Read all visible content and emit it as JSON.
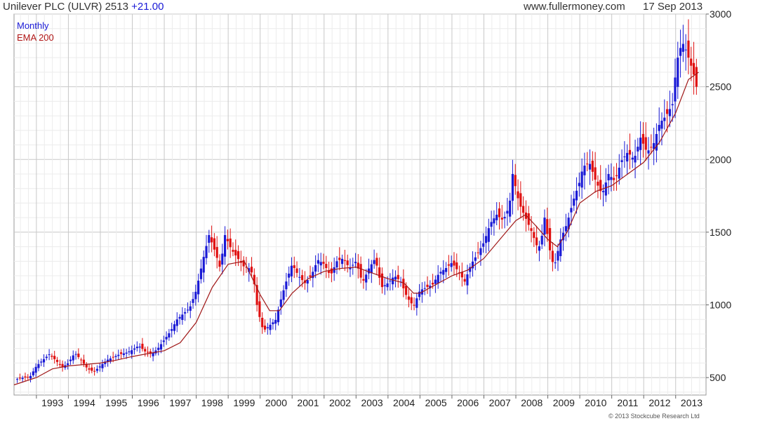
{
  "header": {
    "title_main": "Unilever PLC (ULVR) 2513",
    "title_change": "+21.00",
    "website": "www.fullermoney.com",
    "date": "17 Sep 2013"
  },
  "footer": {
    "copyright": "© 2013 Stockcube Research Ltd"
  },
  "colors": {
    "up": "#1a1ad6",
    "down": "#e01010",
    "ema": "#a01818",
    "grid": "#d8d8d8"
  },
  "chart_data": {
    "type": "candlestick",
    "interval": "Monthly",
    "legend": [
      "Monthly",
      "EMA 200"
    ],
    "legend_placement": "top-left",
    "ylim": [
      380,
      3000
    ],
    "yticks": [
      500,
      1000,
      1500,
      2000,
      2500,
      3000
    ],
    "xlim": [
      1992.3,
      2013.95
    ],
    "xticks": [
      "1993",
      "1994",
      "1995",
      "1996",
      "1997",
      "1998",
      "1999",
      "2000",
      "2001",
      "2002",
      "2003",
      "2004",
      "2005",
      "2006",
      "2007",
      "2008",
      "2009",
      "2010",
      "2011",
      "2012",
      "2013"
    ],
    "grid": true,
    "y_axis_side": "right",
    "close_series": [
      [
        1992.4,
        490
      ],
      [
        1992.6,
        500
      ],
      [
        1992.8,
        505
      ],
      [
        1993.0,
        580
      ],
      [
        1993.2,
        620
      ],
      [
        1993.4,
        660
      ],
      [
        1993.6,
        620
      ],
      [
        1993.8,
        570
      ],
      [
        1994.0,
        600
      ],
      [
        1994.2,
        670
      ],
      [
        1994.4,
        620
      ],
      [
        1994.6,
        560
      ],
      [
        1994.8,
        540
      ],
      [
        1995.0,
        580
      ],
      [
        1995.2,
        620
      ],
      [
        1995.4,
        640
      ],
      [
        1995.6,
        660
      ],
      [
        1995.8,
        670
      ],
      [
        1996.0,
        690
      ],
      [
        1996.2,
        720
      ],
      [
        1996.4,
        680
      ],
      [
        1996.6,
        660
      ],
      [
        1996.8,
        700
      ],
      [
        1997.0,
        760
      ],
      [
        1997.2,
        820
      ],
      [
        1997.4,
        900
      ],
      [
        1997.6,
        940
      ],
      [
        1997.8,
        980
      ],
      [
        1998.0,
        1100
      ],
      [
        1998.2,
        1300
      ],
      [
        1998.4,
        1480
      ],
      [
        1998.6,
        1360
      ],
      [
        1998.75,
        1250
      ],
      [
        1998.9,
        1480
      ],
      [
        1999.1,
        1380
      ],
      [
        1999.3,
        1320
      ],
      [
        1999.5,
        1260
      ],
      [
        1999.7,
        1250
      ],
      [
        1999.8,
        1170
      ],
      [
        1999.9,
        1000
      ],
      [
        2000.0,
        900
      ],
      [
        2000.1,
        820
      ],
      [
        2000.3,
        860
      ],
      [
        2000.5,
        900
      ],
      [
        2000.6,
        1000
      ],
      [
        2000.8,
        1150
      ],
      [
        2001.0,
        1280
      ],
      [
        2001.2,
        1200
      ],
      [
        2001.4,
        1150
      ],
      [
        2001.6,
        1200
      ],
      [
        2001.8,
        1310
      ],
      [
        2002.0,
        1280
      ],
      [
        2002.2,
        1200
      ],
      [
        2002.4,
        1300
      ],
      [
        2002.6,
        1320
      ],
      [
        2002.8,
        1250
      ],
      [
        2003.0,
        1300
      ],
      [
        2003.2,
        1150
      ],
      [
        2003.4,
        1250
      ],
      [
        2003.6,
        1320
      ],
      [
        2003.8,
        1120
      ],
      [
        2004.0,
        1150
      ],
      [
        2004.2,
        1200
      ],
      [
        2004.4,
        1160
      ],
      [
        2004.6,
        1050
      ],
      [
        2004.8,
        990
      ],
      [
        2005.0,
        1100
      ],
      [
        2005.2,
        1120
      ],
      [
        2005.4,
        1140
      ],
      [
        2005.6,
        1220
      ],
      [
        2005.8,
        1250
      ],
      [
        2006.0,
        1290
      ],
      [
        2006.2,
        1230
      ],
      [
        2006.4,
        1160
      ],
      [
        2006.6,
        1280
      ],
      [
        2006.8,
        1350
      ],
      [
        2007.0,
        1430
      ],
      [
        2007.2,
        1560
      ],
      [
        2007.4,
        1620
      ],
      [
        2007.6,
        1580
      ],
      [
        2007.8,
        1680
      ],
      [
        2007.9,
        1900
      ],
      [
        2008.1,
        1700
      ],
      [
        2008.3,
        1600
      ],
      [
        2008.5,
        1500
      ],
      [
        2008.7,
        1380
      ],
      [
        2008.8,
        1450
      ],
      [
        2008.9,
        1600
      ],
      [
        2009.1,
        1330
      ],
      [
        2009.2,
        1260
      ],
      [
        2009.4,
        1450
      ],
      [
        2009.6,
        1560
      ],
      [
        2009.8,
        1720
      ],
      [
        2010.0,
        1850
      ],
      [
        2010.1,
        1950
      ],
      [
        2010.3,
        1980
      ],
      [
        2010.5,
        1850
      ],
      [
        2010.7,
        1760
      ],
      [
        2010.9,
        1900
      ],
      [
        2011.1,
        1850
      ],
      [
        2011.3,
        1990
      ],
      [
        2011.5,
        2050
      ],
      [
        2011.7,
        2000
      ],
      [
        2011.9,
        2150
      ],
      [
        2012.1,
        2050
      ],
      [
        2012.3,
        2100
      ],
      [
        2012.5,
        2250
      ],
      [
        2012.7,
        2300
      ],
      [
        2012.9,
        2380
      ],
      [
        2013.0,
        2600
      ],
      [
        2013.1,
        2750
      ],
      [
        2013.25,
        2800
      ],
      [
        2013.4,
        2700
      ],
      [
        2013.55,
        2600
      ],
      [
        2013.65,
        2500
      ],
      [
        2013.72,
        2513
      ]
    ],
    "ema_series": [
      [
        1992.3,
        450
      ],
      [
        1993.0,
        500
      ],
      [
        1993.5,
        560
      ],
      [
        1994.0,
        580
      ],
      [
        1994.5,
        590
      ],
      [
        1995.0,
        600
      ],
      [
        1995.5,
        620
      ],
      [
        1996.0,
        645
      ],
      [
        1996.5,
        665
      ],
      [
        1997.0,
        685
      ],
      [
        1997.5,
        740
      ],
      [
        1998.0,
        880
      ],
      [
        1998.5,
        1120
      ],
      [
        1999.0,
        1280
      ],
      [
        1999.5,
        1300
      ],
      [
        2000.0,
        1070
      ],
      [
        2000.3,
        960
      ],
      [
        2000.6,
        960
      ],
      [
        2001.0,
        1080
      ],
      [
        2001.5,
        1180
      ],
      [
        2002.0,
        1230
      ],
      [
        2002.5,
        1250
      ],
      [
        2003.0,
        1260
      ],
      [
        2003.5,
        1220
      ],
      [
        2004.0,
        1180
      ],
      [
        2004.5,
        1150
      ],
      [
        2004.8,
        1080
      ],
      [
        2005.0,
        1080
      ],
      [
        2005.5,
        1140
      ],
      [
        2006.0,
        1200
      ],
      [
        2006.5,
        1240
      ],
      [
        2007.0,
        1320
      ],
      [
        2007.5,
        1450
      ],
      [
        2008.0,
        1580
      ],
      [
        2008.3,
        1620
      ],
      [
        2008.6,
        1550
      ],
      [
        2009.0,
        1450
      ],
      [
        2009.3,
        1400
      ],
      [
        2009.6,
        1500
      ],
      [
        2010.0,
        1700
      ],
      [
        2010.5,
        1780
      ],
      [
        2011.0,
        1820
      ],
      [
        2011.5,
        1900
      ],
      [
        2012.0,
        1980
      ],
      [
        2012.5,
        2120
      ],
      [
        2013.0,
        2320
      ],
      [
        2013.4,
        2550
      ],
      [
        2013.72,
        2600
      ]
    ]
  }
}
